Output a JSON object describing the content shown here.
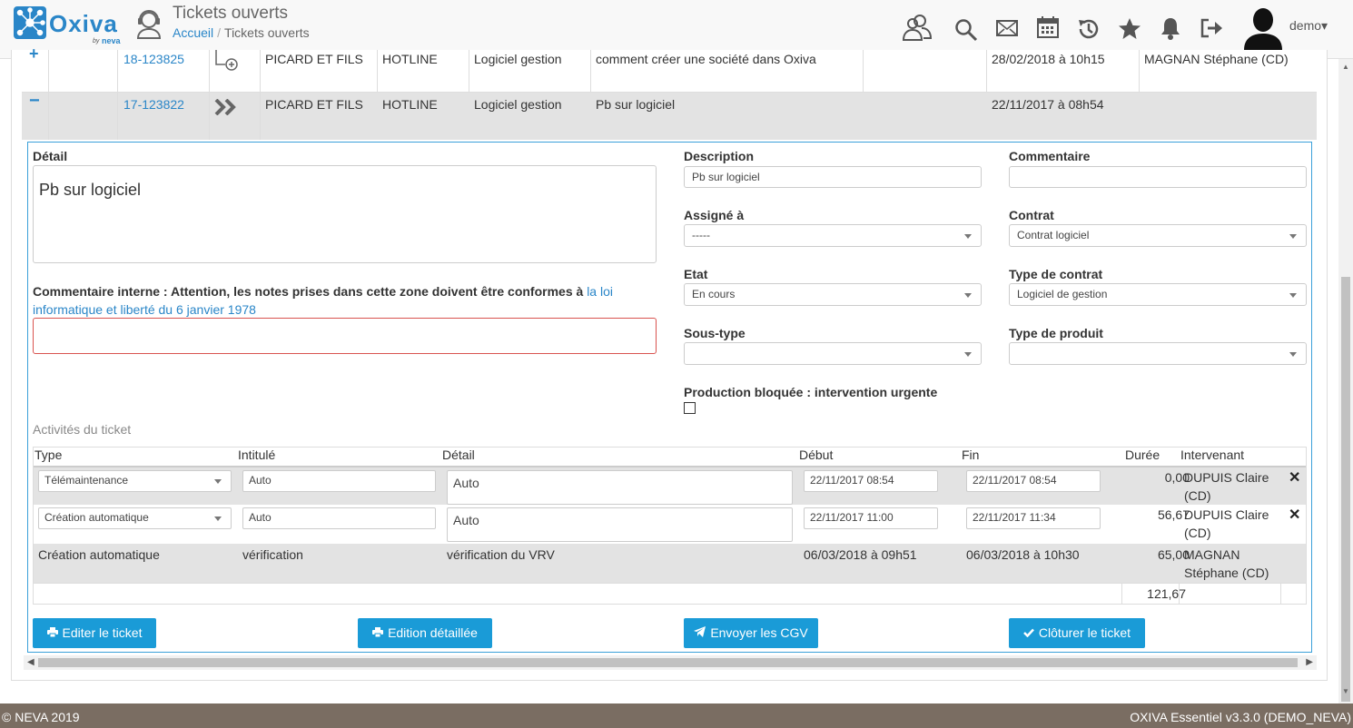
{
  "header": {
    "logo_text": "Oxiva",
    "logo_by": "by",
    "logo_brand": "neva",
    "page_title": "Tickets ouverts",
    "breadcrumb": {
      "home": "Accueil",
      "separator": "/",
      "current": "Tickets ouverts"
    },
    "user_name": "demo▾",
    "toolbar_icons": [
      "users-icon",
      "search-icon",
      "mail-icon",
      "calendar-icon",
      "history-icon",
      "star-icon",
      "bell-icon",
      "logout-icon"
    ]
  },
  "rows": [
    {
      "toggle": "+",
      "ref": "18-123825",
      "client": "PICARD ET FILS",
      "service": "HOTLINE",
      "category": "Logiciel gestion",
      "subject": "comment créer une société dans Oxiva",
      "date": "28/02/2018 à 10h15",
      "assignee": "MAGNAN Stéphane (CD)"
    },
    {
      "toggle": "−",
      "ref": "17-123822",
      "client": "PICARD ET FILS",
      "service": "HOTLINE",
      "category": "Logiciel gestion",
      "subject": "Pb sur logiciel",
      "date": "22/11/2017 à 08h54",
      "assignee": ""
    }
  ],
  "detail": {
    "detail_label": "Détail",
    "detail_value": "Pb sur logiciel",
    "note_label": "Commentaire interne : Attention, les notes prises dans cette zone doivent être conformes à",
    "note_link": "la loi informatique et liberté du 6 janvier 1978",
    "description_label": "Description",
    "description_value": "Pb sur logiciel",
    "commentaire_label": "Commentaire",
    "commentaire_value": "",
    "assigne_label": "Assigné à",
    "assigne_value": "-----",
    "contrat_label": "Contrat",
    "contrat_value": "Contrat logiciel",
    "etat_label": "Etat",
    "etat_value": "En cours",
    "type_contrat_label": "Type de contrat",
    "type_contrat_value": "Logiciel de gestion",
    "sous_type_label": "Sous-type",
    "sous_type_value": "",
    "type_produit_label": "Type de produit",
    "type_produit_value": "",
    "production_label": "Production bloquée : intervention urgente",
    "activities_title": "Activités du ticket"
  },
  "activities": {
    "headers": {
      "type": "Type",
      "intitule": "Intitulé",
      "detail": "Détail",
      "debut": "Début",
      "fin": "Fin",
      "duree": "Durée",
      "intervenant": "Intervenant"
    },
    "rows": [
      {
        "type": "Télémaintenance",
        "intitule": "Auto",
        "detail": "Auto",
        "debut": "22/11/2017 08:54",
        "fin": "22/11/2017 08:54",
        "duree": "0,00",
        "intervenant_1": "DUPUIS Claire",
        "intervenant_2": "(CD)",
        "delete": "✕"
      },
      {
        "type": "Création automatique",
        "intitule": "Auto",
        "detail": "Auto",
        "debut": "22/11/2017 11:00",
        "fin": "22/11/2017 11:34",
        "duree": "56,67",
        "intervenant_1": "DUPUIS Claire",
        "intervenant_2": "(CD)",
        "delete": "✕"
      },
      {
        "type": "Création automatique",
        "intitule": "vérification",
        "detail": "vérification du VRV",
        "debut": "06/03/2018 à 09h51",
        "fin": "06/03/2018 à 10h30",
        "duree": "65,00",
        "intervenant_1": "MAGNAN",
        "intervenant_2": "Stéphane (CD)"
      }
    ],
    "total": "121,67"
  },
  "buttons": {
    "edit": "Editer le ticket",
    "detailed": "Edition détaillée",
    "cgv": "Envoyer les CGV",
    "close": "Clôturer le ticket"
  },
  "footer": {
    "left": "© NEVA 2019",
    "right": "OXIVA Essentiel v3.3.0 (DEMO_NEVA)"
  },
  "colors": {
    "accent": "#1a9bd7",
    "link": "#2a86c8",
    "footer": "#7a6d62",
    "required": "#d9534f"
  }
}
